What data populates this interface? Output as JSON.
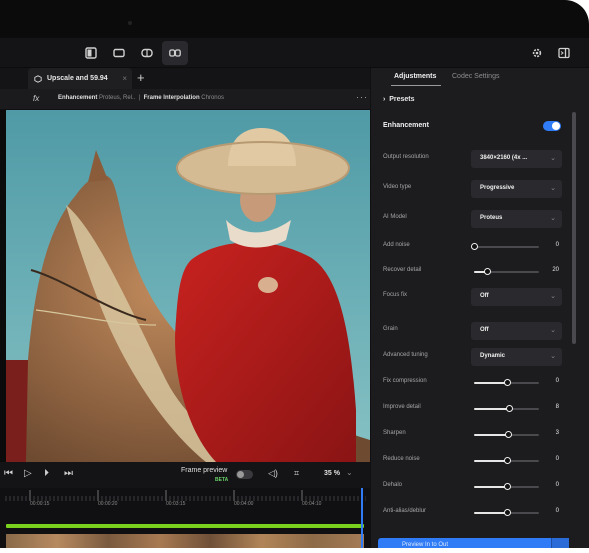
{
  "tab": {
    "label": "Upscale and 59.94",
    "close": "×",
    "add": "+"
  },
  "infobar": {
    "fx": "fx",
    "enh_label": "Enhancement",
    "enh_value": "Proteus, Rel..",
    "fi_label": "Frame Interpolation",
    "fi_value": "Chronos",
    "more": "···"
  },
  "playbar": {
    "frame_preview": "Frame preview",
    "beta": "BETA",
    "zoom": "35 %",
    "zoom_chevron": "⌄"
  },
  "timeline": {
    "ticks": [
      "00:00:15",
      "00:00:20",
      "00:03:15",
      "00:04:00",
      "00:04:10"
    ]
  },
  "panel": {
    "tabs": [
      "Adjustments",
      "Codec Settings"
    ],
    "presets": "Presets",
    "section": "Enhancement",
    "dropdowns": [
      {
        "label": "Output resolution",
        "value": "3840×2160 (4x ..."
      },
      {
        "label": "Video type",
        "value": "Progressive"
      },
      {
        "label": "AI Model",
        "value": "Proteus"
      }
    ],
    "sliders_a": [
      {
        "label": "Add noise",
        "value": "0",
        "fraction": 0.0
      },
      {
        "label": "Recover detail",
        "value": "20",
        "fraction": 0.2
      }
    ],
    "focus_fix": {
      "label": "Focus fix",
      "value": "Off"
    },
    "grain": {
      "label": "Grain",
      "value": "Off"
    },
    "advanced": {
      "label": "Advanced tuning",
      "value": "Dynamic"
    },
    "sliders_b": [
      {
        "label": "Fix compression",
        "value": "0",
        "fraction": 0.5
      },
      {
        "label": "Improve detail",
        "value": "8",
        "fraction": 0.54
      },
      {
        "label": "Sharpen",
        "value": "3",
        "fraction": 0.52
      },
      {
        "label": "Reduce noise",
        "value": "0",
        "fraction": 0.5
      },
      {
        "label": "Dehalo",
        "value": "0",
        "fraction": 0.5
      },
      {
        "label": "Anti-alias/deblur",
        "value": "0",
        "fraction": 0.5
      }
    ],
    "preview_button": "Preview In to Out",
    "chevron": "⌄"
  },
  "colors": {
    "accent": "#2f7cf6",
    "timeline_green": "#7ad11e",
    "panel_bg": "#1c1c1f"
  }
}
